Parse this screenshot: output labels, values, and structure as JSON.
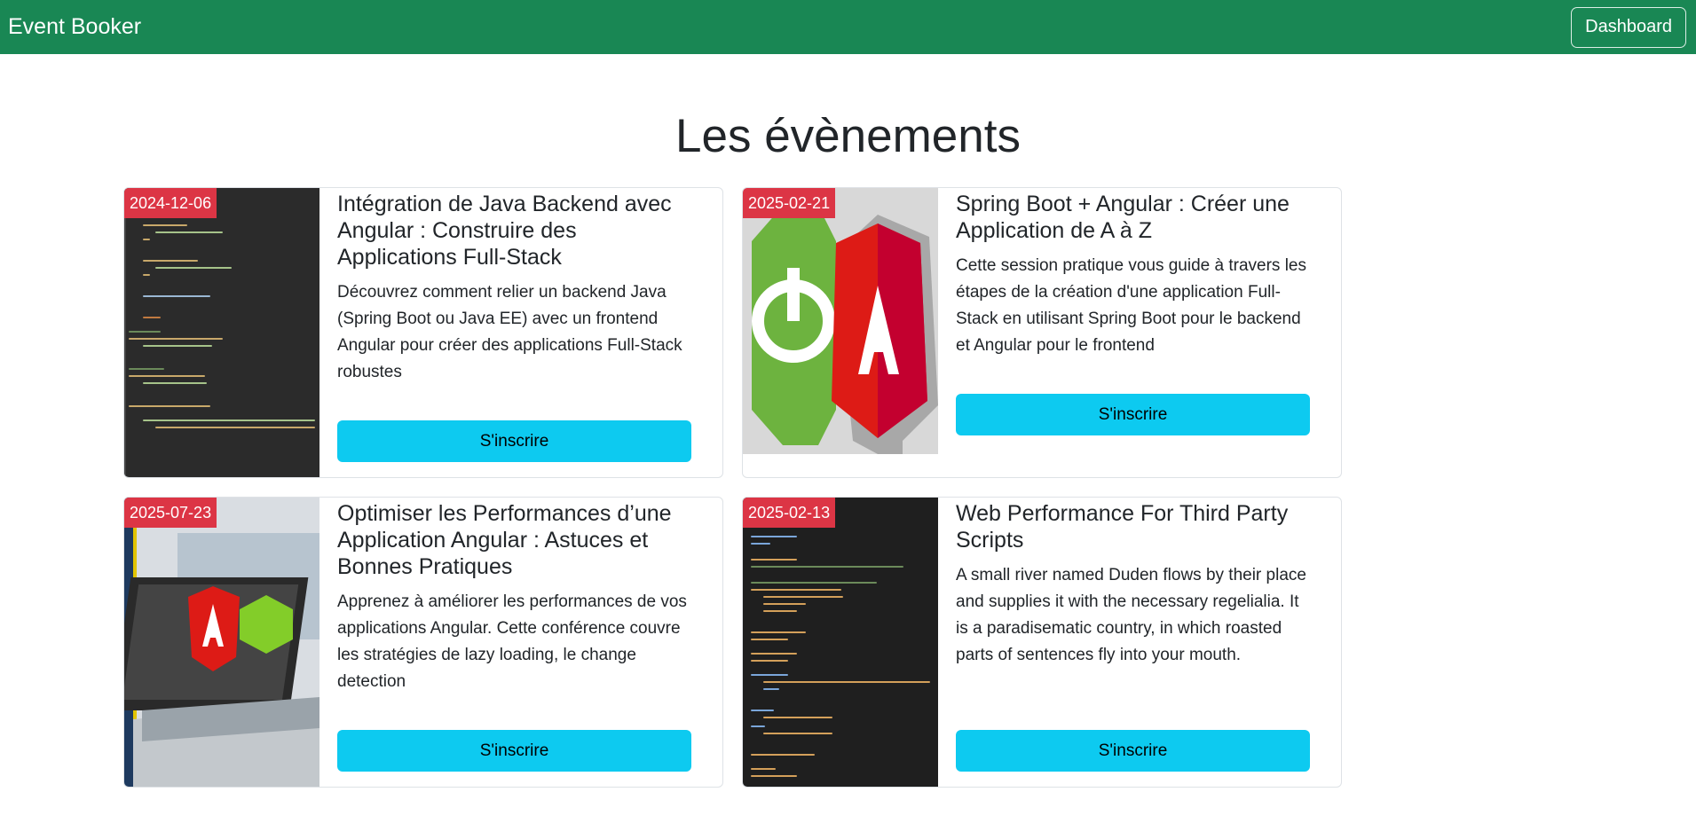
{
  "nav": {
    "brand": "Event Booker",
    "dashboard_label": "Dashboard"
  },
  "page": {
    "title": "Les évènements"
  },
  "events": [
    {
      "date": "2024-12-06",
      "title": "Intégration de Java Backend avec Angular : Construire des Applications Full-Stack",
      "description": "Découvrez comment relier un backend Java (Spring Boot ou Java EE) avec un frontend Angular pour créer des applications Full-Stack robustes",
      "button": "S'inscrire",
      "image_icon": "code-editor-image"
    },
    {
      "date": "2025-02-21",
      "title": "Spring Boot + Angular : Créer une Application de A à Z",
      "description": "Cette session pratique vous guide à travers les étapes de la création d'une application Full-Stack en utilisant Spring Boot pour le backend et Angular pour le frontend",
      "button": "S'inscrire",
      "image_icon": "spring-angular-logo-image"
    },
    {
      "date": "2025-07-23",
      "title": "Optimiser les Performances d’une Application Angular : Astuces et Bonnes Pratiques",
      "description": "Apprenez à améliorer les performances de vos applications Angular. Cette conférence couvre les stratégies de lazy loading, le change detection",
      "button": "S'inscrire",
      "image_icon": "laptop-angular-node-image"
    },
    {
      "date": "2025-02-13",
      "title": "Web Performance For Third Party Scripts",
      "description": "A small river named Duden flows by their place and supplies it with the necessary regelialia. It is a paradisematic country, in which roasted parts of sentences fly into your mouth.",
      "button": "S'inscrire",
      "image_icon": "code-editor-image"
    }
  ],
  "colors": {
    "navbar": "#198754",
    "badge": "#dc3545",
    "button": "#0dcaf0"
  }
}
